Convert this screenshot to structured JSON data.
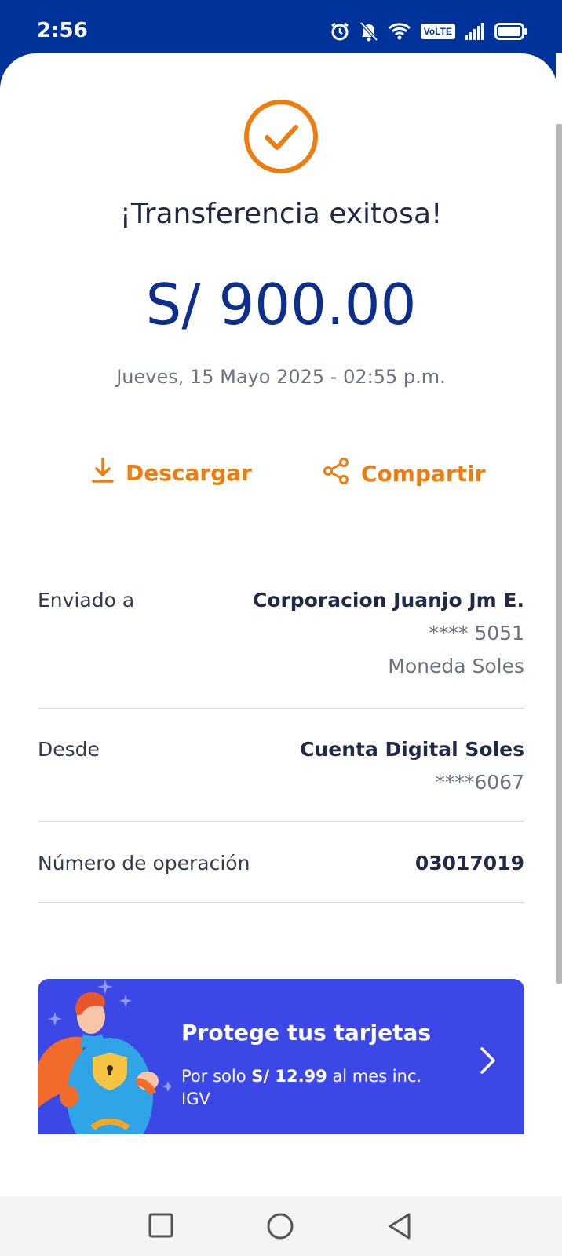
{
  "status_bar": {
    "time": "2:56",
    "network_badge": "VoLTE",
    "icons": [
      "alarm-icon",
      "notifications-off-icon",
      "wifi-icon",
      "volte-icon",
      "signal-icon",
      "battery-icon"
    ]
  },
  "receipt": {
    "title": "¡Transferencia exitosa!",
    "amount": "S/ 900.00",
    "datetime": "Jueves, 15 Mayo 2025 - 02:55 p.m.",
    "download_label": "Descargar",
    "share_label": "Compartir"
  },
  "details": {
    "sent_to": {
      "label": "Enviado a",
      "name": "Corporacion Juanjo Jm E.",
      "account": "**** 5051",
      "currency": "Moneda Soles"
    },
    "from": {
      "label": "Desde",
      "account_name": "Cuenta Digital Soles",
      "account": "****6067"
    },
    "operation": {
      "label": "Número de operación",
      "number": "03017019"
    }
  },
  "promo": {
    "title": "Protege tus tarjetas",
    "desc_prefix": "Por solo ",
    "desc_price": "S/ 12.99",
    "desc_suffix": " al mes inc. IGV"
  },
  "colors": {
    "brand_blue": "#003399",
    "accent_orange": "#EF7D0E",
    "amount_blue": "#0B2F8A",
    "promo_blue": "#3C48E6"
  }
}
